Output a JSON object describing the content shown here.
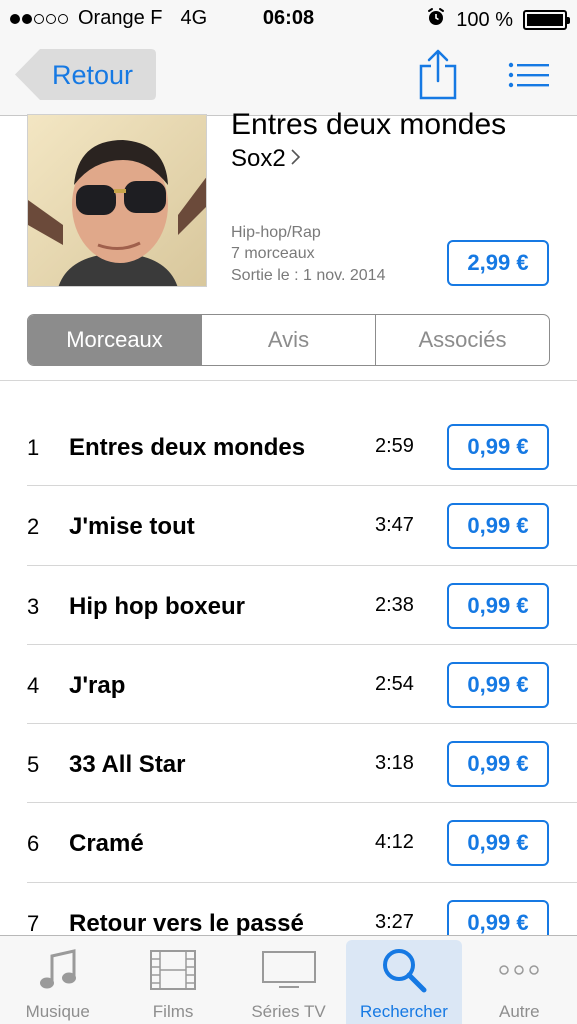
{
  "status_bar": {
    "carrier": "Orange F",
    "network": "4G",
    "time": "06:08",
    "battery_text": "100 %",
    "battery_level": 1.0,
    "signal_bars_filled": 2,
    "signal_bars_total": 5
  },
  "nav": {
    "back_label": "Retour",
    "share_icon": "share-icon",
    "list_icon": "list-icon"
  },
  "album": {
    "title": "Entres deux mondes",
    "artist": "Sox2",
    "genre": "Hip-hop/Rap",
    "track_count": "7 morceaux",
    "release": "Sortie le : 1 nov. 2014",
    "price": "2,99 €"
  },
  "segments": {
    "tracks": "Morceaux",
    "reviews": "Avis",
    "related": "Associés",
    "selected": "Morceaux"
  },
  "tracks": [
    {
      "num": "1",
      "name": "Entres deux mondes",
      "duration": "2:59",
      "price": "0,99 €"
    },
    {
      "num": "2",
      "name": "J'mise tout",
      "duration": "3:47",
      "price": "0,99 €"
    },
    {
      "num": "3",
      "name": "Hip hop boxeur",
      "duration": "2:38",
      "price": "0,99 €"
    },
    {
      "num": "4",
      "name": "J'rap",
      "duration": "2:54",
      "price": "0,99 €"
    },
    {
      "num": "5",
      "name": "33 All Star",
      "duration": "3:18",
      "price": "0,99 €"
    },
    {
      "num": "6",
      "name": "Cramé",
      "duration": "4:12",
      "price": "0,99 €"
    },
    {
      "num": "7",
      "name": "Retour vers le passé",
      "duration": "3:27",
      "price": "0,99 €"
    }
  ],
  "tab_bar": {
    "music": "Musique",
    "films": "Films",
    "tv": "Séries TV",
    "search": "Rechercher",
    "more": "Autre",
    "active": "Rechercher"
  },
  "colors": {
    "accent": "#1679e3",
    "segment_gray": "#8c8c8c",
    "bar_bg": "#f7f7f7"
  }
}
